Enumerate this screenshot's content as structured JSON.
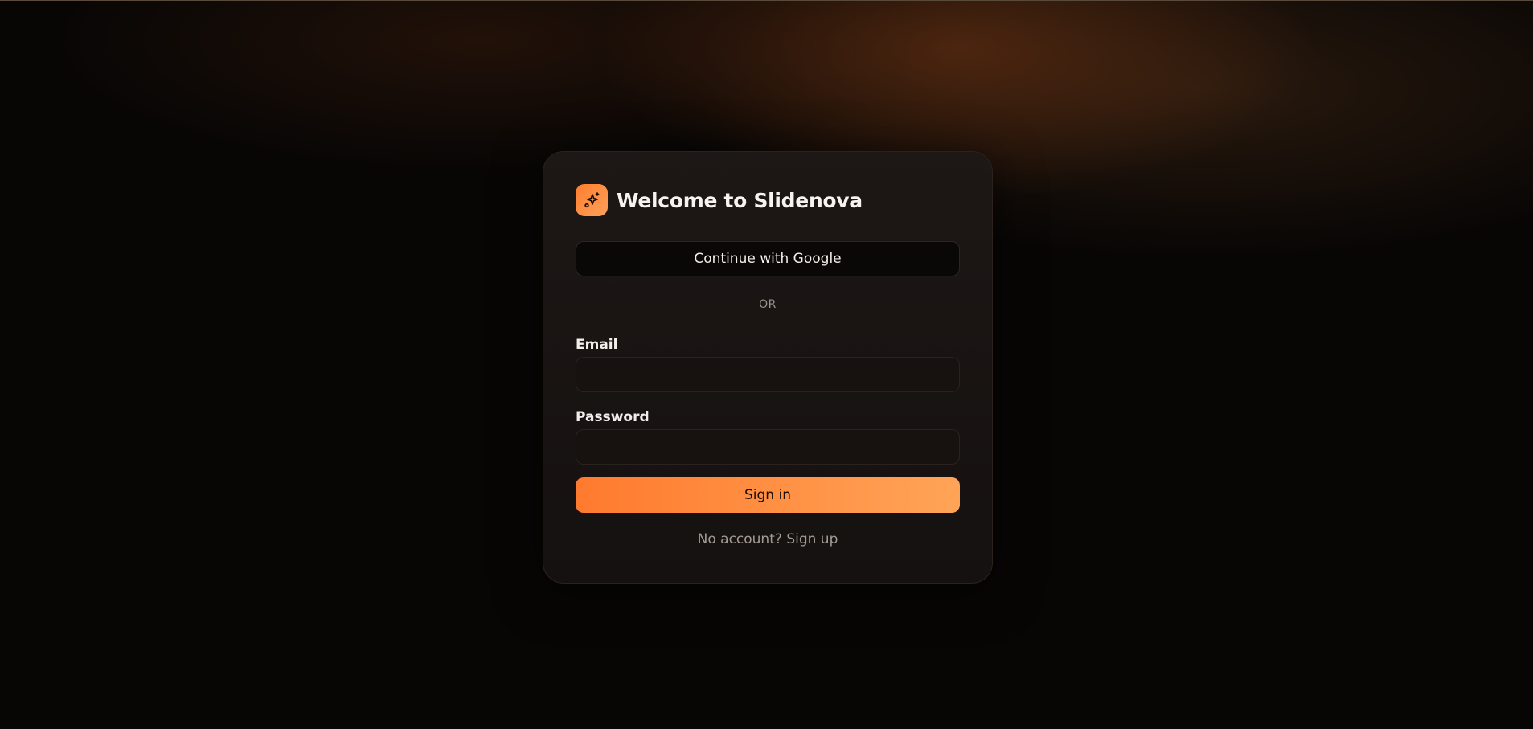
{
  "app": {
    "title": "Welcome to Slidenova",
    "logo_icon": "sparkles-icon",
    "accent_color": "#ff8a3d"
  },
  "auth": {
    "google_label": "Continue with Google",
    "divider_label": "OR",
    "email_label": "Email",
    "email_value": "",
    "password_label": "Password",
    "password_value": "",
    "signin_label": "Sign in",
    "signup_prompt": "No account?",
    "signup_link": "Sign up"
  }
}
